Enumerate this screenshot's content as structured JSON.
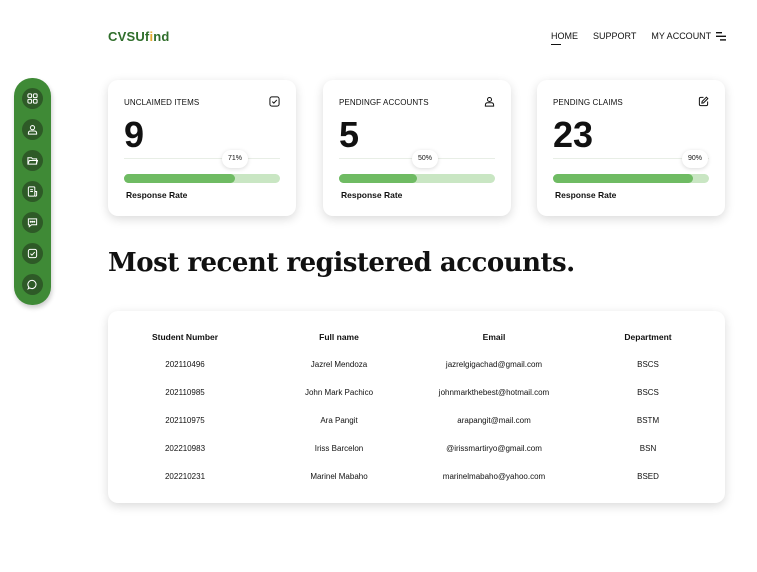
{
  "header": {
    "logo_main": "CVSUf",
    "logo_accent": "i",
    "logo_end": "nd",
    "nav": [
      "HOME",
      "SUPPORT",
      "MY ACCOUNT"
    ],
    "menu_icon": "menu-icon"
  },
  "sidebar": {
    "items": [
      {
        "name": "dashboard",
        "icon": "grid-icon"
      },
      {
        "name": "users",
        "icon": "user-icon"
      },
      {
        "name": "folders",
        "icon": "folder-icon"
      },
      {
        "name": "reports",
        "icon": "document-icon"
      },
      {
        "name": "messages",
        "icon": "message-icon"
      },
      {
        "name": "claims",
        "icon": "checkbox-icon"
      },
      {
        "name": "chat",
        "icon": "chat-bubble-icon"
      }
    ]
  },
  "cards": [
    {
      "title": "UNCLAIMED ITEMS",
      "value": "9",
      "percent_label": "71%",
      "percent": 71,
      "rate_label": "Response Rate",
      "icon": "checkbox-icon"
    },
    {
      "title": "PENDINGF ACCOUNTS",
      "value": "5",
      "percent_label": "50%",
      "percent": 50,
      "rate_label": "Response Rate",
      "icon": "user-icon"
    },
    {
      "title": "PENDING CLAIMS",
      "value": "23",
      "percent_label": "90%",
      "percent": 90,
      "rate_label": "Response Rate",
      "icon": "edit-icon"
    }
  ],
  "section_title": "Most recent registered accounts.",
  "table": {
    "headers": [
      "Student Number",
      "Full name",
      "Email",
      "Department"
    ],
    "rows": [
      [
        "202110496",
        "Jazrel Mendoza",
        "jazrelgigachad@gmail.com",
        "BSCS"
      ],
      [
        "202110985",
        "John Mark Pachico",
        "johnmarkthebest@hotmail.com",
        "BSCS"
      ],
      [
        "202110975",
        "Ara Pangit",
        "arapangit@mail.com",
        "BSTM"
      ],
      [
        "202210983",
        "Iriss Barcelon",
        "@irissmartiryo@gmail.com",
        "BSN"
      ],
      [
        "202210231",
        "Marinel Mabaho",
        "marinelmabaho@yahoo.com",
        "BSED"
      ]
    ]
  },
  "colors": {
    "brand_green": "#2f6e2b",
    "sidebar_green": "#3f8a36",
    "bar_fill": "#6fbb63",
    "bar_track": "#c9e6c3",
    "logo_accent": "#e4a72a"
  }
}
